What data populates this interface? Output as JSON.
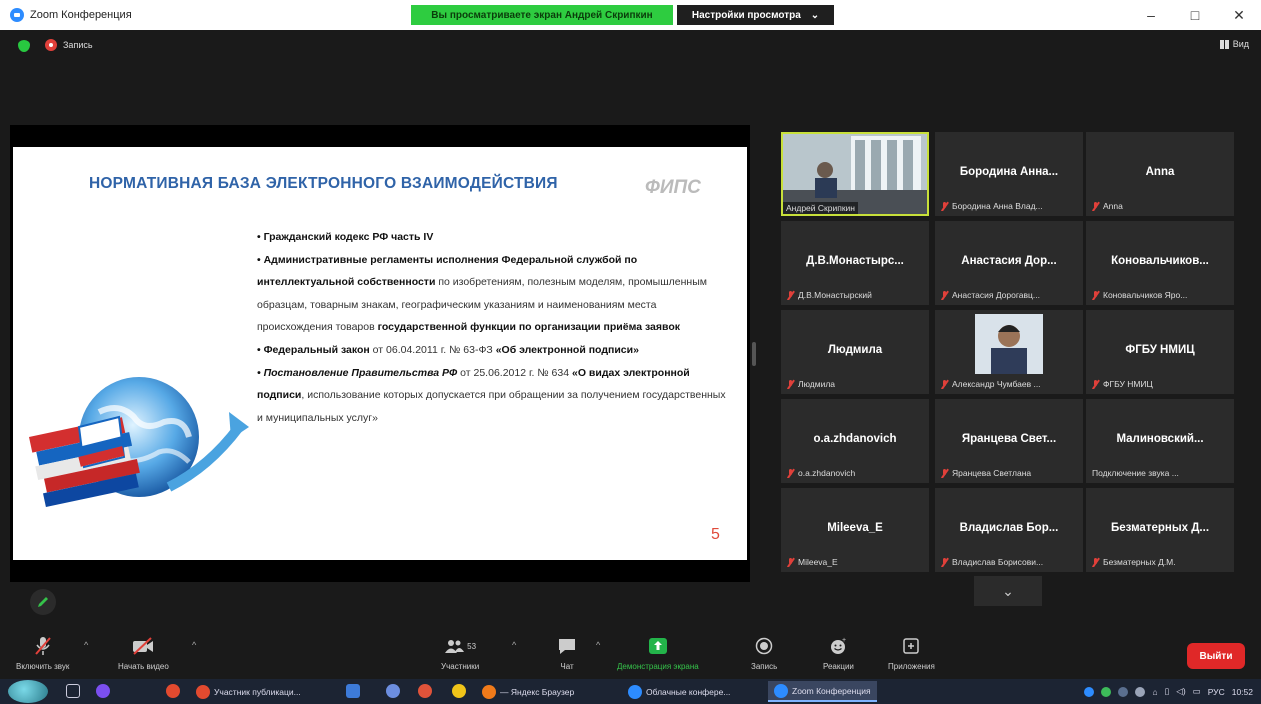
{
  "window": {
    "title": "Zoom Конференция",
    "share_banner": "Вы просматриваете экран Андрей Скрипкин",
    "view_options": "Настройки просмотра",
    "controls": {
      "minimize": "–",
      "maximize": "□",
      "close": "✕"
    }
  },
  "meeting": {
    "recording_label": "Запись",
    "view_label": "Вид"
  },
  "slide": {
    "title": "НОРМАТИВНАЯ БАЗА ЭЛЕКТРОННОГО ВЗАИМОДЕЙСТВИЯ",
    "logo": "ФИПС",
    "page_number": "5",
    "body": {
      "p1": "• Гражданский кодекс РФ часть IV",
      "p2_bold": "• Административные регламенты исполнения Федеральной службой по интеллектуальной собственности",
      "p2_rest": " по изобретениям, полезным моделям, промышленным образцам, товарным знакам, географическим указаниям и наименованиям места происхождения товаров ",
      "p2_bold2": "государственной функции по организации приёма заявок",
      "p3_bold": "• Федеральный закон",
      "p3_rest": " от 06.04.2011 г. № 63-ФЗ ",
      "p3_bold2": "«Об электронной подписи»",
      "p4_bold": "• Постановление Правительства РФ",
      "p4_rest": " от 25.06.2012 г. № 634 ",
      "p4_bold2": "«О видах электронной подписи",
      "p4_rest2": ", использование которых допускается при обращении за получением государственных и муниципальных услуг»"
    }
  },
  "participants": [
    {
      "name": "",
      "sub": "Андрей Скрипкин",
      "video": "window",
      "muted": false,
      "active": true
    },
    {
      "name": "Бородина Анна...",
      "sub": "Бородина Анна Влад...",
      "muted": true
    },
    {
      "name": "Anna",
      "sub": "Anna",
      "muted": true
    },
    {
      "name": "Д.В.Монастырс...",
      "sub": "Д.В.Монастырский",
      "muted": true
    },
    {
      "name": "Анастасия Дор...",
      "sub": "Анастасия Дорогавц...",
      "muted": true
    },
    {
      "name": "Коновальчиков...",
      "sub": "Коновальчиков Яро...",
      "muted": true
    },
    {
      "name": "Людмила",
      "sub": "Людмила",
      "muted": true
    },
    {
      "name": "",
      "sub": "Александр Чумбаев ...",
      "video": "person",
      "muted": true
    },
    {
      "name": "ФГБУ НМИЦ",
      "sub": "ФГБУ НМИЦ",
      "muted": true
    },
    {
      "name": "o.a.zhdanovich",
      "sub": "o.a.zhdanovich",
      "muted": true
    },
    {
      "name": "Яранцева Свет...",
      "sub": "Яранцева Светлана",
      "muted": true
    },
    {
      "name": "Малиновский...",
      "sub": "Подключение звука ...",
      "muted": false
    },
    {
      "name": "Mileeva_E",
      "sub": "Mileeva_E",
      "muted": true
    },
    {
      "name": "Владислав Бор...",
      "sub": "Владислав Борисови...",
      "muted": true
    },
    {
      "name": "Безматерных Д...",
      "sub": "Безматерных Д.М.",
      "muted": true
    }
  ],
  "toolbar": {
    "audio": "Включить звук",
    "video": "Начать видео",
    "participants": "Участники",
    "participants_count": "53",
    "chat": "Чат",
    "share": "Демонстрация экрана",
    "record": "Запись",
    "reactions": "Реакции",
    "apps": "Приложения",
    "leave": "Выйти"
  },
  "taskbar": {
    "apps": [
      "Участник публикаци...",
      "— Яндекс Браузер",
      "Облачные конфере...",
      "Zoom Конференция"
    ],
    "lang": "РУС",
    "time": "10:52"
  },
  "colors": {
    "accent_green": "#2ecc40",
    "leave_red": "#e02828",
    "slide_title_blue": "#2f63a8",
    "active_speaker": "#c8e03a"
  }
}
